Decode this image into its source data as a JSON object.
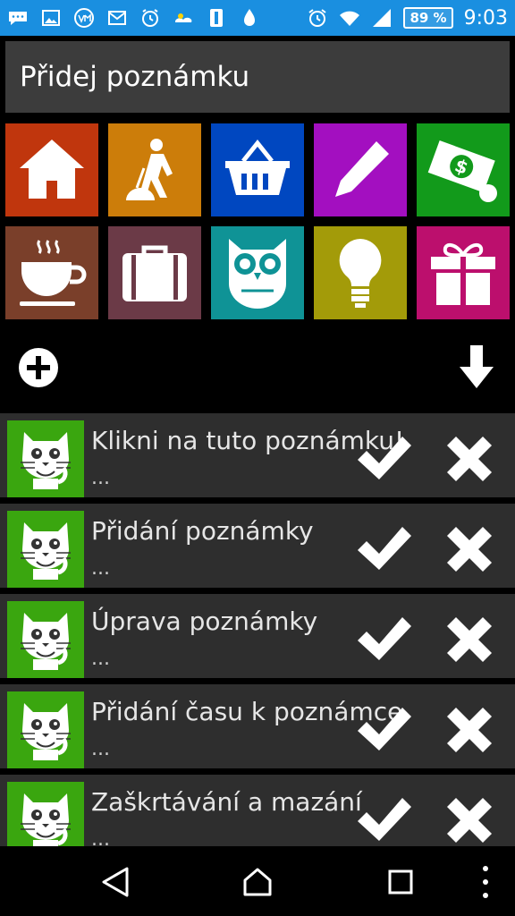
{
  "status_bar": {
    "battery": "89 %",
    "time": "9:03",
    "icons": [
      "chat-icon",
      "image-icon",
      "vmd-icon",
      "gmail-icon",
      "alarm-clock-icon",
      "weather-icon",
      "sim-icon",
      "water-drop-icon",
      "alarm-icon",
      "wifi-icon",
      "signal-icon"
    ]
  },
  "header": {
    "title": "Přidej poznámku"
  },
  "categories": [
    {
      "icon": "house-icon",
      "color": "#c0360d"
    },
    {
      "icon": "worker-icon",
      "color": "#cc7d0a"
    },
    {
      "icon": "basket-icon",
      "color": "#0047c0"
    },
    {
      "icon": "pencil-icon",
      "color": "#a30fc0"
    },
    {
      "icon": "money-icon",
      "color": "#129a1b"
    },
    {
      "icon": "coffee-icon",
      "color": "#7a3f2a"
    },
    {
      "icon": "briefcase-icon",
      "color": "#6b3a47"
    },
    {
      "icon": "owl-icon",
      "color": "#0f9396"
    },
    {
      "icon": "lightbulb-icon",
      "color": "#a39b09"
    },
    {
      "icon": "gift-icon",
      "color": "#bc0f6d"
    }
  ],
  "toolbar": {
    "add_icon": "plus-circle-icon",
    "sort_icon": "arrow-down-icon"
  },
  "notes": [
    {
      "title": "Klikni na tuto poznámku!",
      "subtitle": "..."
    },
    {
      "title": "Přidání poznámky",
      "subtitle": "..."
    },
    {
      "title": "Úprava poznámky",
      "subtitle": "..."
    },
    {
      "title": "Přidání času k poznámce",
      "subtitle": "..."
    },
    {
      "title": "Zaškrtávání a mazání",
      "subtitle": "..."
    }
  ],
  "nav": {
    "back": "back-icon",
    "home": "home-icon",
    "recent": "recents-icon",
    "menu": "overflow-menu-icon"
  }
}
